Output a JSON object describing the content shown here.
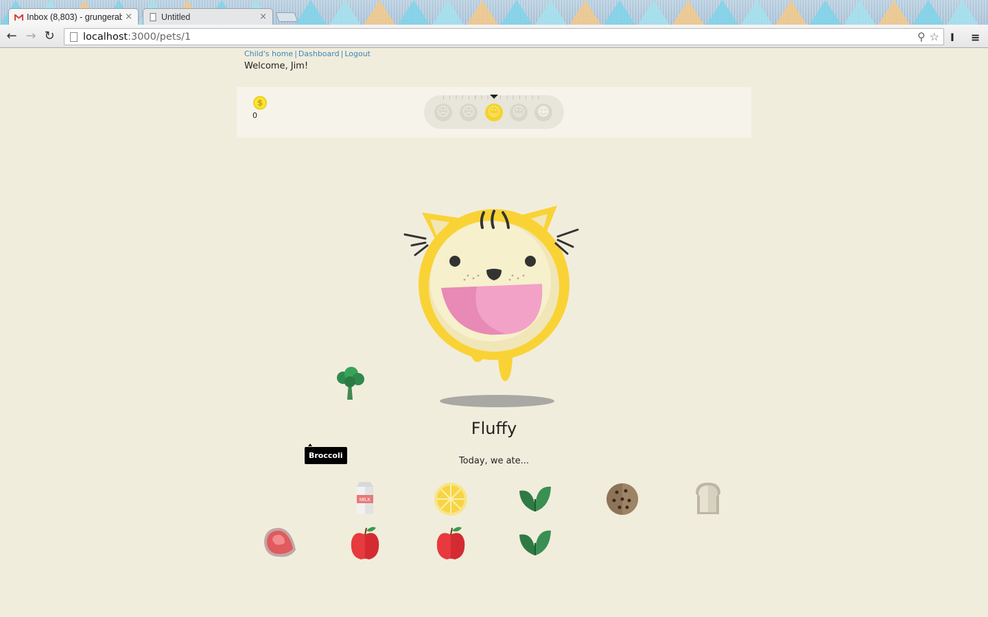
{
  "browser": {
    "tabs": [
      {
        "title": "Inbox (8,803) - grungerab",
        "favicon": "gmail-icon",
        "active": true
      },
      {
        "title": "Untitled",
        "favicon": "page-icon",
        "active": false
      }
    ],
    "url": {
      "host": "localhost",
      "rest": ":3000/pets/1"
    },
    "close_glyph": "×"
  },
  "nav": {
    "links": [
      "Child's home",
      "Dashboard",
      "Logout"
    ],
    "separator": "|",
    "welcome": "Welcome, Jim!"
  },
  "status": {
    "coins": "0",
    "coin_symbol": "$",
    "mood_faces": [
      "very-sad",
      "sad",
      "neutral",
      "happy",
      "very-happy"
    ],
    "mood_current_index": 2
  },
  "pet": {
    "name": "Fluffy",
    "ate_label": "Today, we ate..."
  },
  "dragging": {
    "food": "broccoli",
    "tooltip": "Broccoli"
  },
  "eaten_foods": [
    [
      "milk",
      "lemon",
      "spinach",
      "cookie",
      "bread"
    ],
    [
      "meat",
      "apple",
      "apple",
      "spinach"
    ]
  ],
  "milk_label": "MILK",
  "colors": {
    "background": "#f1eddc",
    "link": "#3a86b8",
    "pet_yellow": "#f9d335",
    "pet_face": "#f6f0cc",
    "pet_mouth": "#f2a2c7",
    "mood_active": "#f6d32a"
  }
}
